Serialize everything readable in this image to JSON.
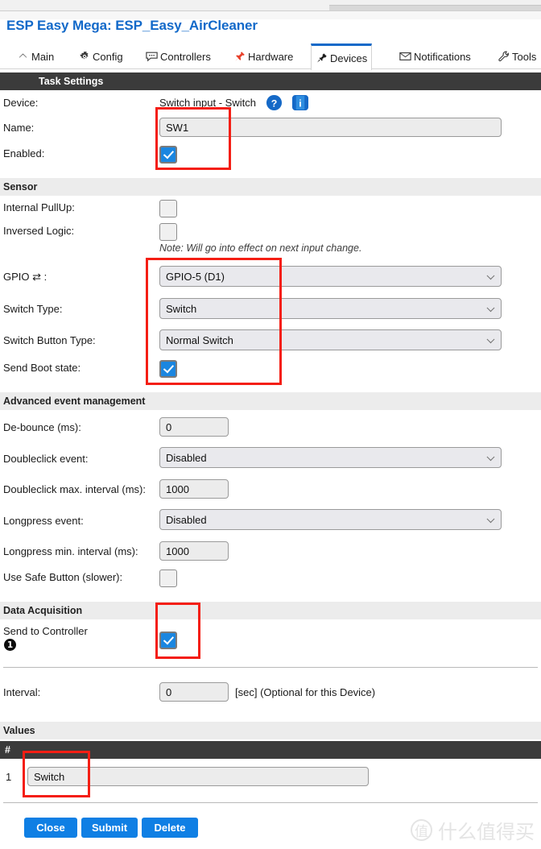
{
  "header": {
    "title": "ESP Easy Mega: ESP_Easy_AirCleaner"
  },
  "tabs": [
    {
      "label": "Main",
      "icon": "home-icon",
      "active": false
    },
    {
      "label": "Config",
      "icon": "gear-icon",
      "active": false
    },
    {
      "label": "Controllers",
      "icon": "speech-bubble-icon",
      "active": false
    },
    {
      "label": "Hardware",
      "icon": "pushpin-icon",
      "active": false
    },
    {
      "label": "Devices",
      "icon": "plug-icon",
      "active": true
    },
    {
      "label": "Notifications",
      "icon": "envelope-icon",
      "active": false
    },
    {
      "label": "Tools",
      "icon": "wrench-icon",
      "active": false
    }
  ],
  "sections": {
    "task_settings": "Task Settings",
    "sensor": "Sensor",
    "advanced": "Advanced event management",
    "data_acquisition": "Data Acquisition",
    "values": "Values"
  },
  "task": {
    "device_label": "Device:",
    "device_value": "Switch input - Switch",
    "help_icon": "question-mark-icon",
    "info_icon": "info-icon",
    "name_label": "Name:",
    "name_value": "SW1",
    "enabled_label": "Enabled:",
    "enabled_checked": true
  },
  "sensor": {
    "pullup_label": "Internal PullUp:",
    "pullup_checked": false,
    "inversed_label": "Inversed Logic:",
    "inversed_checked": false,
    "note": "Note: Will go into effect on next input change.",
    "gpio_label": "GPIO ⇄ :",
    "gpio_value": "GPIO-5 (D1)",
    "switch_type_label": "Switch Type:",
    "switch_type_value": "Switch",
    "button_type_label": "Switch Button Type:",
    "button_type_value": "Normal Switch",
    "boot_state_label": "Send Boot state:",
    "boot_state_checked": true
  },
  "advanced": {
    "debounce_label": "De-bounce (ms):",
    "debounce_value": "0",
    "doubleclick_event_label": "Doubleclick event:",
    "doubleclick_event_value": "Disabled",
    "doubleclick_interval_label": "Doubleclick max. interval (ms):",
    "doubleclick_interval_value": "1000",
    "longpress_event_label": "Longpress event:",
    "longpress_event_value": "Disabled",
    "longpress_interval_label": "Longpress min. interval (ms):",
    "longpress_interval_value": "1000",
    "safe_button_label": "Use Safe Button (slower):",
    "safe_button_checked": false
  },
  "data_acquisition": {
    "send_to_controller_label": "Send to Controller",
    "controller_badge": "1",
    "send_to_controller_checked": true,
    "interval_label": "Interval:",
    "interval_value": "0",
    "interval_hint": "[sec] (Optional for this Device)"
  },
  "values": {
    "col_index": "#",
    "rows": [
      {
        "index": "1",
        "name": "Switch"
      }
    ]
  },
  "footer": {
    "close": "Close",
    "submit": "Submit",
    "delete": "Delete"
  },
  "watermark": {
    "mark": "值",
    "text": "什么值得买"
  }
}
